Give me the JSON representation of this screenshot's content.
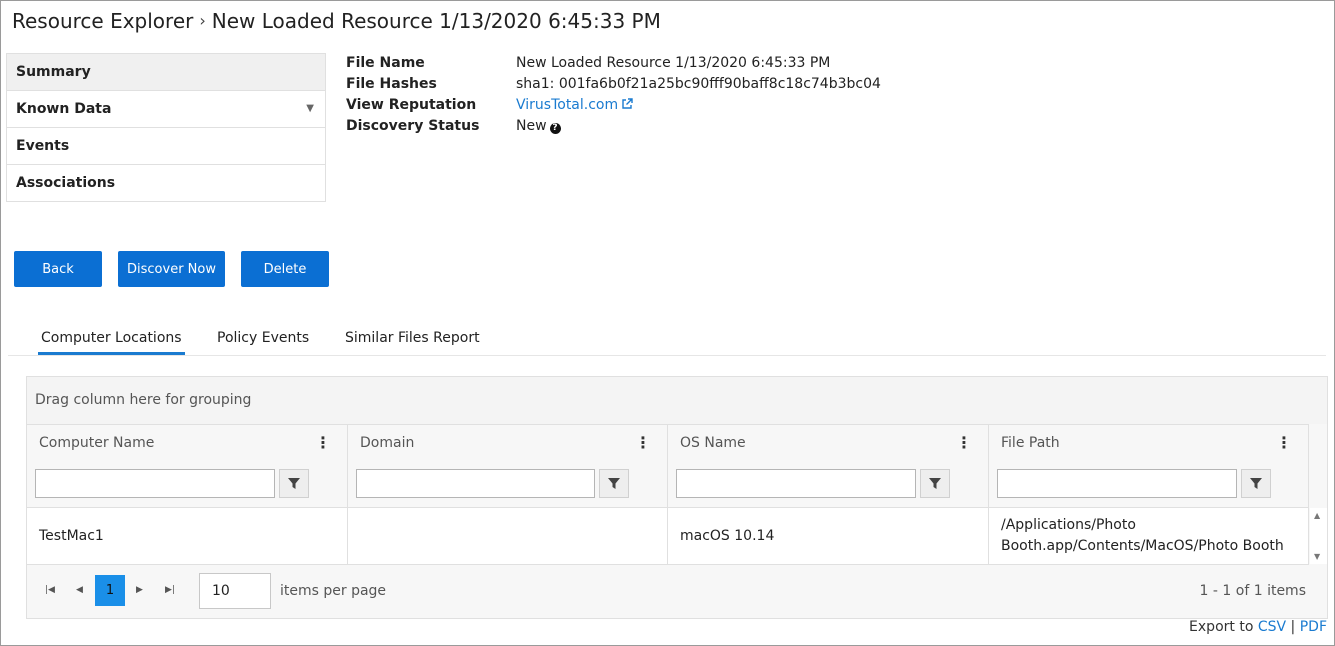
{
  "breadcrumb": {
    "root": "Resource Explorer",
    "separator": "›",
    "current": "New Loaded Resource 1/13/2020 6:45:33 PM"
  },
  "sidebar": {
    "items": [
      {
        "label": "Summary"
      },
      {
        "label": "Known Data"
      },
      {
        "label": "Events"
      },
      {
        "label": "Associations"
      }
    ]
  },
  "details": {
    "file_name_label": "File Name",
    "file_name_value": "New Loaded Resource 1/13/2020 6:45:33 PM",
    "file_hashes_label": "File Hashes",
    "file_hashes_value": "sha1: 001fa6b0f21a25bc90fff90baff8c18c74b3bc04",
    "view_reputation_label": "View Reputation",
    "view_reputation_link": "VirusTotal.com",
    "discovery_status_label": "Discovery Status",
    "discovery_status_value": "New"
  },
  "buttons": {
    "back": "Back",
    "discover_now": "Discover Now",
    "delete": "Delete"
  },
  "tabs": [
    {
      "label": "Computer Locations"
    },
    {
      "label": "Policy Events"
    },
    {
      "label": "Similar Files Report"
    }
  ],
  "grid": {
    "group_hint": "Drag column here for grouping",
    "columns": [
      "Computer Name",
      "Domain",
      "OS Name",
      "File Path"
    ],
    "rows": [
      [
        "TestMac1",
        "",
        "macOS 10.14",
        "/Applications/Photo Booth.app/Contents/MacOS/Photo Booth"
      ]
    ],
    "pager": {
      "current_page": "1",
      "page_size": "10",
      "page_size_label": "items per page",
      "count_text": "1 - 1 of 1 items"
    }
  },
  "export": {
    "prefix": "Export to",
    "csv": "CSV",
    "divider": "|",
    "pdf": "PDF"
  },
  "colors": {
    "accent": "#0b6fd3",
    "link": "#1a7bd0",
    "page_active": "#1a8fe8"
  }
}
